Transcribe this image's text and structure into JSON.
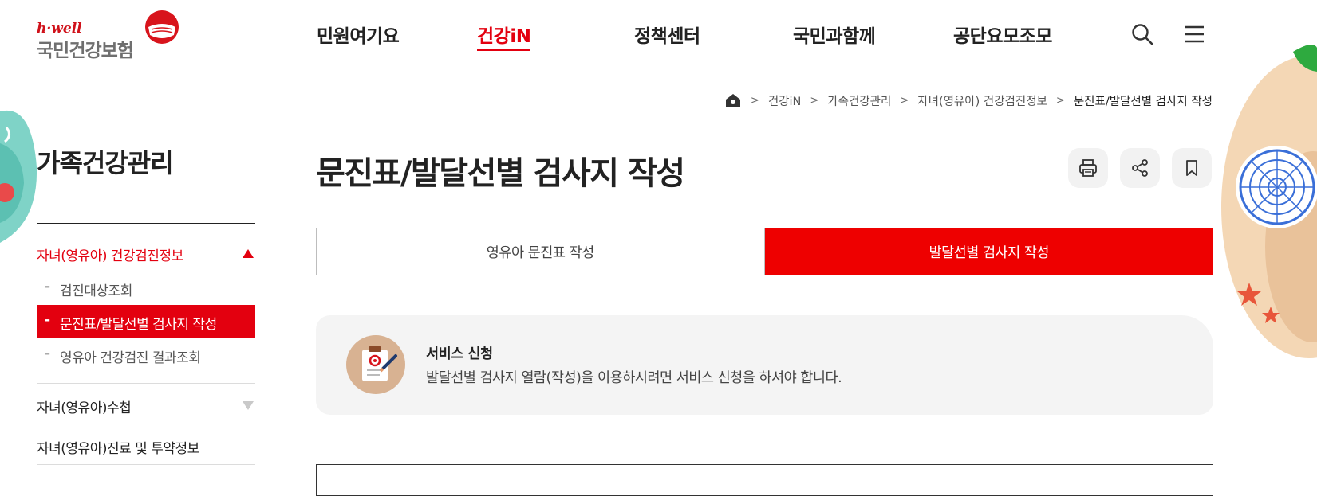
{
  "logo": {
    "brand_small": "h·well",
    "brand_name": "국민건강보험"
  },
  "gnb": {
    "items": [
      {
        "label": "민원여기요"
      },
      {
        "label": "건강iN"
      },
      {
        "label": "정책센터"
      },
      {
        "label": "국민과함께"
      },
      {
        "label": "공단요모조모"
      }
    ],
    "active_index": 1
  },
  "header_icons": {
    "search": "search-icon",
    "menu": "hamburger-menu-icon"
  },
  "breadcrumb": {
    "home_icon": "home-icon",
    "items": [
      "건강iN",
      "가족건강관리",
      "자녀(영유아) 건강검진정보",
      "문진표/발달선별 검사지 작성"
    ]
  },
  "sidebar": {
    "title": "가족건강관리",
    "groups": [
      {
        "label": "자녀(영유아) 건강검진정보",
        "expanded": true
      },
      {
        "label": "자녀(영유아)수첩",
        "expanded": false
      },
      {
        "label": "자녀(영유아)진료 및 투약정보",
        "expanded": false
      }
    ],
    "sub_items": [
      {
        "label": "검진대상조회"
      },
      {
        "label": "문진표/발달선별 검사지 작성"
      },
      {
        "label": "영유아 건강검진 결과조회"
      }
    ],
    "active_sub_index": 1
  },
  "page": {
    "title": "문진표/발달선별 검사지 작성",
    "tools": [
      "print-icon",
      "share-icon",
      "bookmark-icon"
    ]
  },
  "tabs": [
    {
      "label": "영유아 문진표 작성"
    },
    {
      "label": "발달선별 검사지 작성"
    }
  ],
  "active_tab": 1,
  "notice": {
    "icon": "clipboard-pen-icon",
    "title": "서비스 신청",
    "description": "발달선별 검사지 열람(작성)을 이용하시려면 서비스 신청을 하셔야 합니다."
  },
  "colors": {
    "accent": "#e3000f",
    "tab_active": "#ee0000",
    "notice_bg": "#f4f4f4"
  }
}
